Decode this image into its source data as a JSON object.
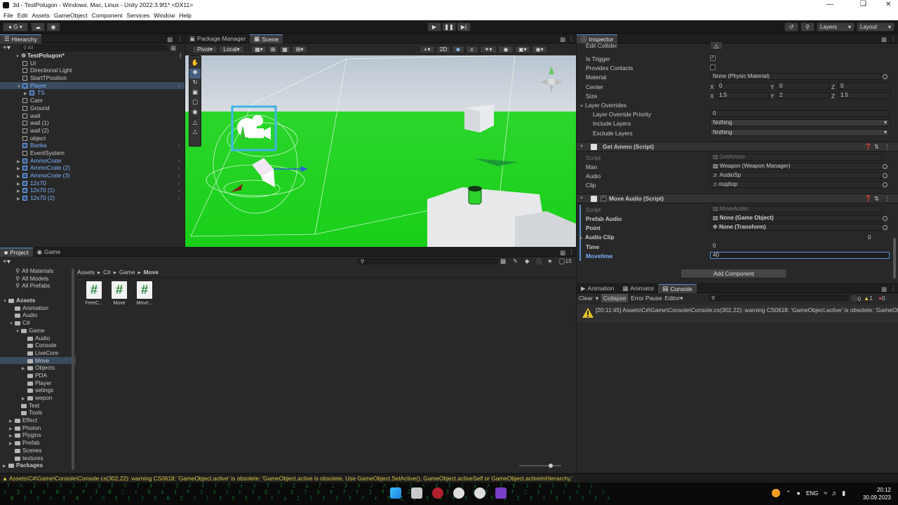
{
  "window": {
    "title": "3d - TestPolugon - Windows, Mac, Linux - Unity 2022.3.9f1* <DX11>"
  },
  "menu": [
    "File",
    "Edit",
    "Assets",
    "GameObject",
    "Component",
    "Services",
    "Window",
    "Help"
  ],
  "toolbar": {
    "account": "G",
    "layers": "Layers",
    "layout": "Layout"
  },
  "hierarchy": {
    "tab": "Hierarchy",
    "search_placeholder": "All",
    "scene": "TestPolugon*",
    "items": [
      {
        "label": "UI",
        "indent": 1,
        "blue": false,
        "sel": false,
        "arrow": false
      },
      {
        "label": "Directional Light",
        "indent": 1,
        "blue": false,
        "sel": false,
        "arrow": false
      },
      {
        "label": "StartTPosition",
        "indent": 1,
        "blue": false,
        "sel": false,
        "arrow": false
      },
      {
        "label": "Player",
        "indent": 1,
        "blue": true,
        "sel": true,
        "arrow": true,
        "open": true,
        "chev": true
      },
      {
        "label": "TS",
        "indent": 2,
        "blue": true,
        "sel": false,
        "arrow": true
      },
      {
        "label": "Cam",
        "indent": 1,
        "blue": false,
        "sel": false,
        "arrow": false
      },
      {
        "label": "Ground",
        "indent": 1,
        "blue": false,
        "sel": false,
        "arrow": false
      },
      {
        "label": "wall",
        "indent": 1,
        "blue": false,
        "sel": false,
        "arrow": false
      },
      {
        "label": "wall (1)",
        "indent": 1,
        "blue": false,
        "sel": false,
        "arrow": false
      },
      {
        "label": "wall (2)",
        "indent": 1,
        "blue": false,
        "sel": false,
        "arrow": false
      },
      {
        "label": "object",
        "indent": 1,
        "blue": false,
        "sel": false,
        "arrow": false
      },
      {
        "label": "Banka",
        "indent": 1,
        "blue": true,
        "sel": false,
        "arrow": false,
        "chev": true
      },
      {
        "label": "EventSystem",
        "indent": 1,
        "blue": false,
        "sel": false,
        "arrow": false
      },
      {
        "label": "AmmoCrate",
        "indent": 1,
        "blue": true,
        "sel": false,
        "arrow": true,
        "chev": true
      },
      {
        "label": "AmmoCrate (2)",
        "indent": 1,
        "blue": true,
        "sel": false,
        "arrow": true,
        "chev": true
      },
      {
        "label": "AmmoCrate (3)",
        "indent": 1,
        "blue": true,
        "sel": false,
        "arrow": true,
        "chev": true
      },
      {
        "label": "12x70",
        "indent": 1,
        "blue": true,
        "sel": false,
        "arrow": true,
        "chev": true
      },
      {
        "label": "12x70 (1)",
        "indent": 1,
        "blue": true,
        "sel": false,
        "arrow": true,
        "chev": true
      },
      {
        "label": "12x70 (2)",
        "indent": 1,
        "blue": true,
        "sel": false,
        "arrow": true,
        "chev": true
      }
    ]
  },
  "scene": {
    "tabs": [
      "Package Manager",
      "Scene"
    ],
    "pivot": "Pivot",
    "local": "Local",
    "mode2d": "2D"
  },
  "project": {
    "tabs": [
      "Project",
      "Game"
    ],
    "favorites": [
      "All Materials",
      "All Models",
      "All Prefabs"
    ],
    "tree": [
      {
        "label": "Assets",
        "indent": 0,
        "bold": true,
        "open": true
      },
      {
        "label": "Animation",
        "indent": 1
      },
      {
        "label": "Audio",
        "indent": 1
      },
      {
        "label": "C#",
        "indent": 1,
        "open": true
      },
      {
        "label": "Game",
        "indent": 2,
        "open": true
      },
      {
        "label": "Audio",
        "indent": 3
      },
      {
        "label": "Console",
        "indent": 3
      },
      {
        "label": "LiveCore",
        "indent": 3
      },
      {
        "label": "Move",
        "indent": 3,
        "sel": true
      },
      {
        "label": "Objects",
        "indent": 3,
        "arrow": true
      },
      {
        "label": "PDA",
        "indent": 3
      },
      {
        "label": "Player",
        "indent": 3
      },
      {
        "label": "setings",
        "indent": 3
      },
      {
        "label": "wepon",
        "indent": 3,
        "arrow": true
      },
      {
        "label": "Test",
        "indent": 2
      },
      {
        "label": "Tools",
        "indent": 2
      },
      {
        "label": "Effect",
        "indent": 1,
        "arrow": true
      },
      {
        "label": "Photon",
        "indent": 1,
        "arrow": true
      },
      {
        "label": "Plygins",
        "indent": 1,
        "arrow": true
      },
      {
        "label": "Prefab",
        "indent": 1,
        "arrow": true
      },
      {
        "label": "Scenes",
        "indent": 1
      },
      {
        "label": "textures",
        "indent": 1
      },
      {
        "label": "Packages",
        "indent": 0,
        "bold": true,
        "arrow": true
      }
    ],
    "breadcrumb": [
      "Assets",
      "C#",
      "Game",
      "Move"
    ],
    "files": [
      "FreeC...",
      "Move",
      "Move..."
    ],
    "count": "15"
  },
  "inspector": {
    "tab": "Inspector",
    "collider": {
      "edit_collider": "Edit Collider",
      "is_trigger": "Is Trigger",
      "provides_contacts": "Provides Contacts",
      "material_label": "Material",
      "material_value": "None (Physic Material)",
      "center_label": "Center",
      "center": {
        "x": "0",
        "y": "0",
        "z": "0"
      },
      "size_label": "Size",
      "size": {
        "x": "1.5",
        "y": "2",
        "z": "1.5"
      },
      "layer_overrides": "Layer Overrides",
      "priority_label": "Layer Override Priority",
      "priority_value": "0",
      "include_label": "Include Layers",
      "include_value": "Nothing",
      "exclude_label": "Exclude Layers",
      "exclude_value": "Nothing"
    },
    "get_ammo": {
      "title": "Get Ammo (Script)",
      "script_label": "Script",
      "script_value": "GetAmmo",
      "man_label": "Man",
      "man_value": "Weapon (Weapon Manager)",
      "audio_label": "Audio",
      "audio_value": "AudioSp",
      "clip_label": "Clip",
      "clip_value": "подбор"
    },
    "move_audio": {
      "title": "Move Audio (Script)",
      "script_label": "Script",
      "script_value": "MoveAudio",
      "prefab_label": "Prefab Audio",
      "prefab_value": "None (Game Object)",
      "point_label": "Point",
      "point_value": "None (Transform)",
      "clip_label": "Audio Clip",
      "clip_value": "0",
      "time_label": "Time",
      "time_value": "0",
      "movetime_label": "Movetime",
      "movetime_value": "40"
    },
    "add_component": "Add Component"
  },
  "console": {
    "tabs": [
      "Animation",
      "Animator",
      "Console"
    ],
    "clear": "Clear",
    "collapse": "Collapse",
    "error_pause": "Error Pause",
    "editor": "Editor",
    "counts": {
      "info": "0",
      "warn": "1",
      "error": "0"
    },
    "message": "[20:11:45] Assets\\C#\\Game\\Console\\Console.cs(302,22): warning CS0618: 'GameObject.active' is obsolete: 'GameObject.active is obsolete. Use GameObject.SetActive(), GameObject.activeSelf or GameObject.activeInHierarchy.'"
  },
  "status": {
    "message": "Assets\\C#\\Game\\Console\\Console.cs(302,22): warning CS0618: 'GameObject.active' is obsolete: 'GameObject.active is obsolete. Use GameObject.SetActive(), GameObject.activeSelf or GameObject.activeInHierarchy.'"
  },
  "taskbar": {
    "lang": "ENG",
    "time": "20:12",
    "date": "30.09.2023"
  },
  "colors": {
    "accent": "#5a8fd6",
    "prefab": "#7cb2ff",
    "ground": "#1fd81f",
    "warning": "#e0c94a"
  }
}
